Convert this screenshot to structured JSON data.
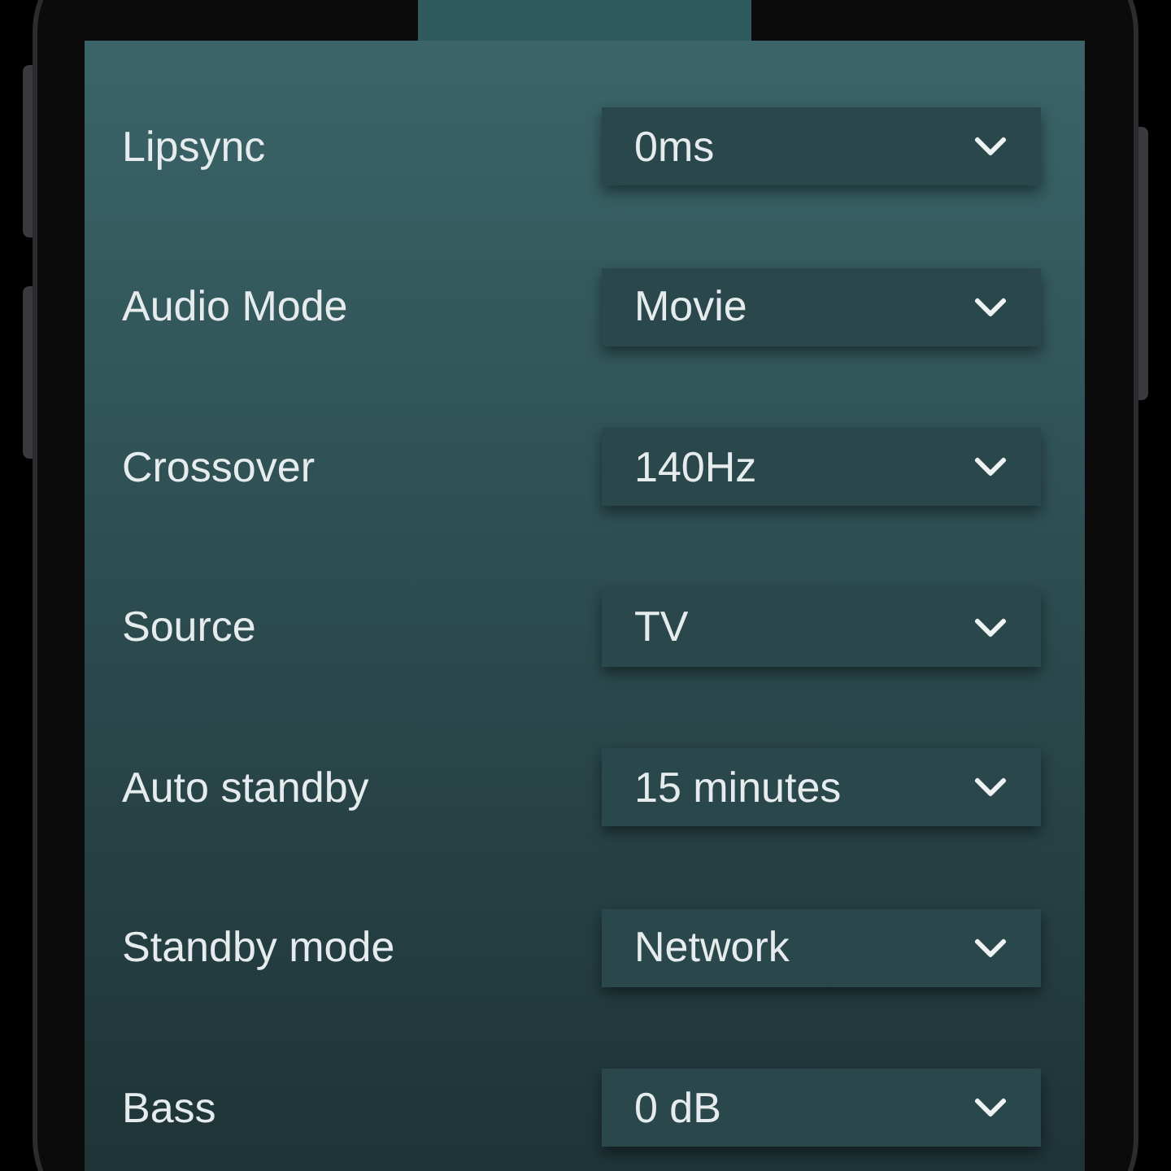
{
  "settings": [
    {
      "label": "Lipsync",
      "value": "0ms"
    },
    {
      "label": "Audio Mode",
      "value": "Movie"
    },
    {
      "label": "Crossover",
      "value": "140Hz"
    },
    {
      "label": "Source",
      "value": "TV"
    },
    {
      "label": "Auto standby",
      "value": "15 minutes"
    },
    {
      "label": "Standby mode",
      "value": "Network"
    },
    {
      "label": "Bass",
      "value": "0 dB"
    }
  ]
}
